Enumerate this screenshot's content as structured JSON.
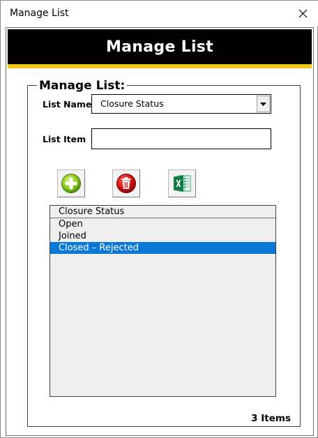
{
  "window": {
    "title": "Manage List"
  },
  "banner": {
    "title": "Manage List"
  },
  "group": {
    "title": "Manage List:",
    "list_name_label": "List Name",
    "list_name_value": "Closure Status",
    "list_item_label": "List Item",
    "list_item_value": ""
  },
  "toolbar": {
    "add_icon": "add-icon",
    "delete_icon": "trash-icon",
    "export_icon": "excel-icon"
  },
  "listbox": {
    "header": "Closure Status",
    "items": [
      "Open",
      "Joined",
      "Closed – Rejected"
    ],
    "selected_index": 2
  },
  "count_text": "3 Items",
  "colors": {
    "banner_bg": "#000000",
    "banner_stripe": "#f5c518",
    "selection": "#0a78d7",
    "list_bg": "#efefef"
  }
}
